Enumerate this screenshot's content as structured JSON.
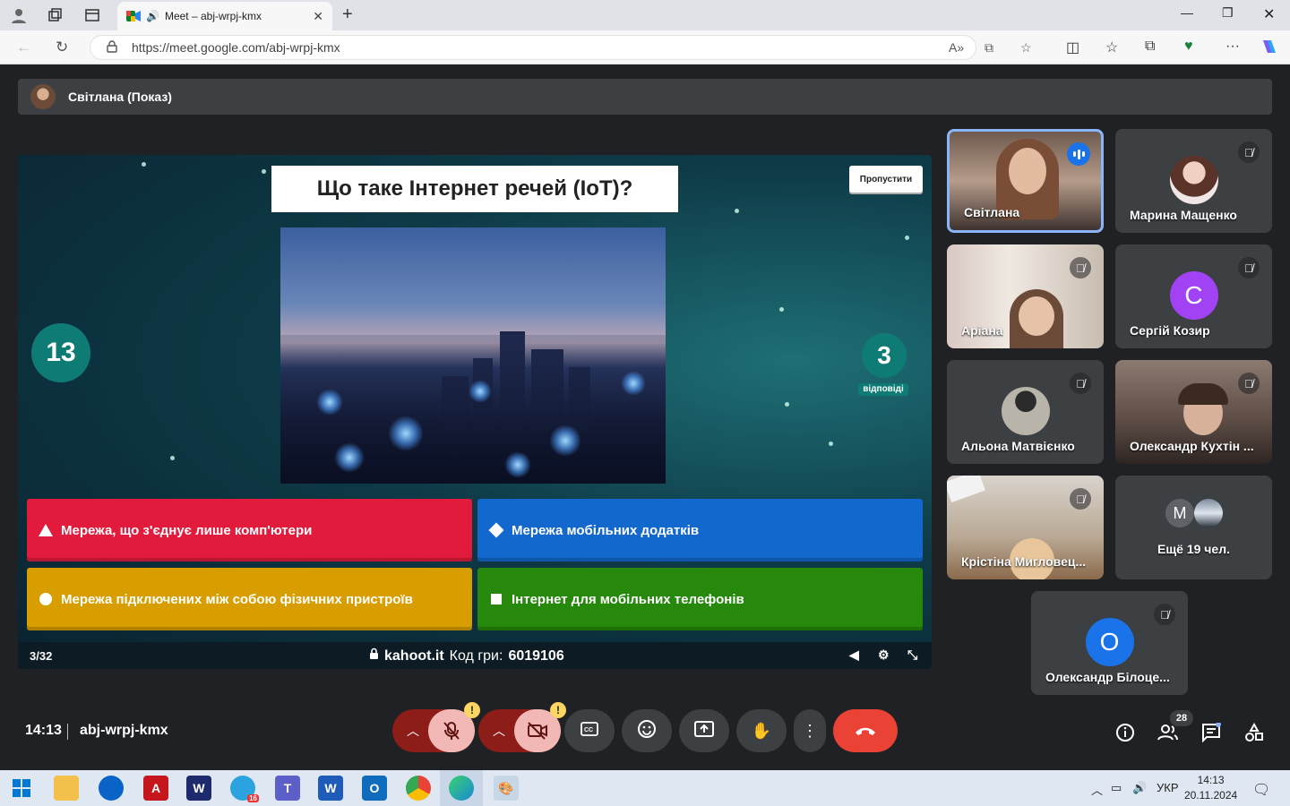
{
  "browser": {
    "tab_title": "Meet – abj-wrpj-kmx",
    "url": "https://meet.google.com/abj-wrpj-kmx"
  },
  "presentation": {
    "banner": "Світлана (Показ)"
  },
  "kahoot": {
    "question": "Що таке Інтернет речей (IoT)?",
    "skip_label": "Пропустити",
    "timer": "13",
    "answers_count": "3",
    "answers_label": "відповіді",
    "answers": [
      {
        "text": "Мережа, що з'єднує лише комп'ютери",
        "color": "#e21b3c",
        "shape": "triangle-icon"
      },
      {
        "text": "Мережа мобільних додатків",
        "color": "#1368ce",
        "shape": "diamond-icon"
      },
      {
        "text": "Мережа підключених між собою фізичних пристроїв",
        "color": "#d89e00",
        "shape": "circle-icon"
      },
      {
        "text": "Інтернет для мобільних телефонів",
        "color": "#26890c",
        "shape": "square-icon"
      }
    ],
    "progress": "3/32",
    "site": "kahoot.it",
    "pin_label": "Код гри:",
    "pin": "6019106"
  },
  "participants": [
    {
      "name": "Світлана",
      "speaking": true
    },
    {
      "name": "Марина Мащенко",
      "muted": true
    },
    {
      "name": "Аріана",
      "muted": true
    },
    {
      "name": "Сергій Козир",
      "initial": "С",
      "color": "#a142f4",
      "muted": true
    },
    {
      "name": "Альона Матвієнко",
      "muted": true
    },
    {
      "name": "Олександр Кухтін ...",
      "muted": true
    },
    {
      "name": "Крістіна Мигловец...",
      "muted": true
    },
    {
      "name": "Ещё 19 чел.",
      "initial": "M"
    },
    {
      "name": "Олександр Білоце...",
      "initial": "O",
      "color": "#1a73e8",
      "muted": true
    }
  ],
  "bottom_bar": {
    "time": "14:13",
    "meeting_code": "abj-wrpj-kmx",
    "people_count": "28",
    "mic_warning": "!",
    "cam_warning": "!"
  },
  "taskbar": {
    "language": "УКР",
    "time": "14:13",
    "date": "20.11.2024",
    "telegram_badge": "16"
  }
}
